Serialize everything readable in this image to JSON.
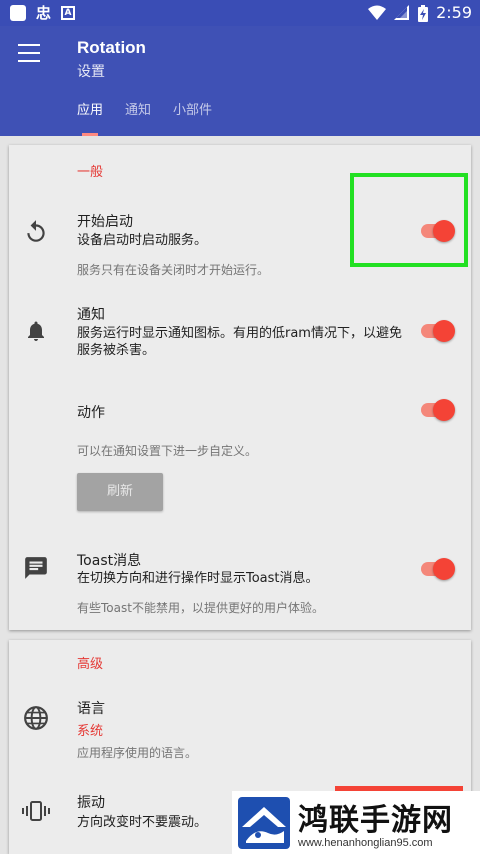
{
  "status_bar": {
    "glyph": "忠",
    "letter": "A",
    "time": "2:59"
  },
  "app_bar": {
    "title": "Rotation",
    "subtitle": "设置",
    "tabs": [
      {
        "label": "应用",
        "active": true
      },
      {
        "label": "通知",
        "active": false
      },
      {
        "label": "小部件",
        "active": false
      }
    ]
  },
  "general": {
    "header": "一般",
    "start_on_boot": {
      "title": "开始启动",
      "subtitle": "设备启动时启动服务。",
      "hint": "服务只有在设备关闭时才开始运行。",
      "enabled": true
    },
    "notification": {
      "title": "通知",
      "subtitle": "服务运行时显示通知图标。有用的低ram情况下，以避免服务被杀害。",
      "enabled": true
    },
    "action": {
      "title": "动作",
      "hint": "可以在通知设置下进一步自定义。",
      "enabled": true,
      "button_label": "刷新"
    },
    "toast": {
      "title": "Toast消息",
      "subtitle": "在切换方向和进行操作时显示Toast消息。",
      "hint": "有些Toast不能禁用，以提供更好的用户体验。",
      "enabled": true
    }
  },
  "advanced": {
    "header": "高级",
    "language": {
      "title": "语言",
      "value": "系统",
      "hint": "应用程序使用的语言。"
    },
    "vibration": {
      "title": "振动",
      "subtitle": "方向改变时不要震动。"
    }
  },
  "watermark": {
    "title": "鸿联手游网",
    "url": "www.henanhonglian95.com"
  },
  "colors": {
    "primary": "#3f51b5",
    "status_bar": "#3a4db5",
    "accent": "#f44336",
    "highlight": "#22e022"
  }
}
